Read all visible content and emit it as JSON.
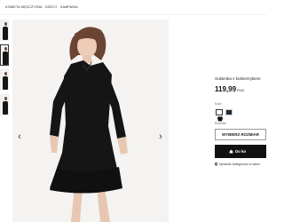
{
  "nav": {
    "items": [
      "KOBIETA",
      "MĘŻCZYZNA",
      "DZIECI",
      "KAMPANIA"
    ]
  },
  "gallery": {
    "prev_icon": "chevron-left-icon",
    "next_icon": "chevron-right-icon",
    "prev_glyph": "‹",
    "next_glyph": "›"
  },
  "product": {
    "name": "Sukienka z kołnierzykiem",
    "price": "119,99",
    "currency": "PLN"
  },
  "color": {
    "label": "Kolor",
    "swatches": [
      {
        "name": "black-dress",
        "hex": "#111111",
        "selected": true
      },
      {
        "name": "navy-dress",
        "hex": "#1c2a3a",
        "selected": false
      }
    ]
  },
  "size": {
    "label": "Rozmiar",
    "button_label": "WYBIERZ ROZMIAR"
  },
  "cart": {
    "button_label": "Do ko"
  },
  "store": {
    "link_label": "Sprawdź dostępność w salon"
  },
  "colors": {
    "accent": "#111111",
    "background": "#ffffff",
    "photo_bg": "#f4f3f1"
  }
}
